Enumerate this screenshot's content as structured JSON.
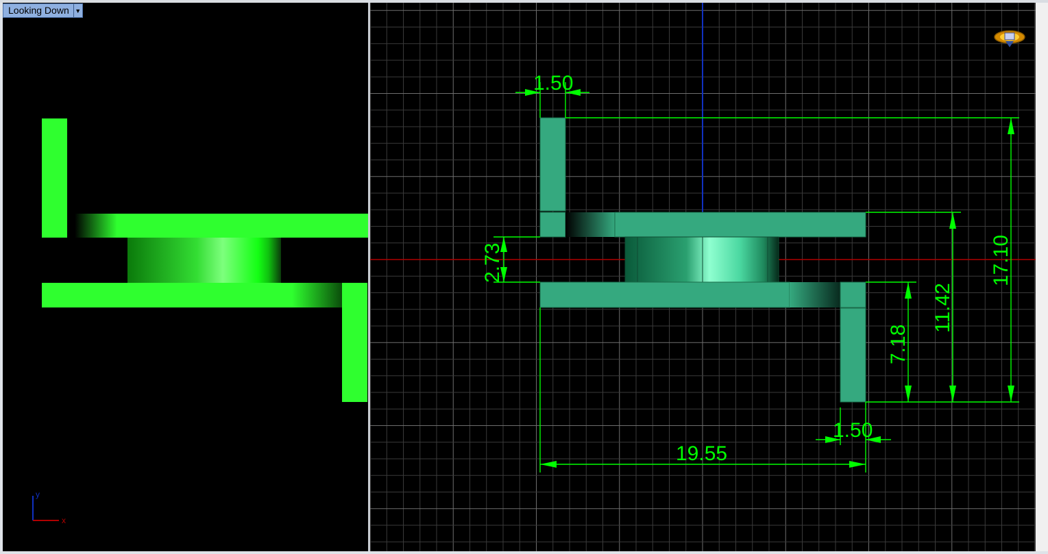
{
  "viewport_left": {
    "title": "Looking Down",
    "dropdown_icon": "chevron-down-icon",
    "axis": {
      "x_label": "x",
      "y_label": "y"
    }
  },
  "viewport_right": {
    "orientation_widget_icon": "view-cube-icon",
    "dimensions": {
      "top_width": "1.50",
      "bottom_width": "1.50",
      "overall_width": "19.55",
      "gap": "2.73",
      "height_small": "7.18",
      "height_mid": "11.42",
      "height_total": "17.10"
    }
  },
  "colors": {
    "shaded_green": "#2fff2f",
    "render_green": "#35a97f",
    "dimension_green": "#00ff00",
    "grid": "#4a4a4a",
    "x_axis": "#b00000",
    "y_axis": "#1030c0"
  }
}
